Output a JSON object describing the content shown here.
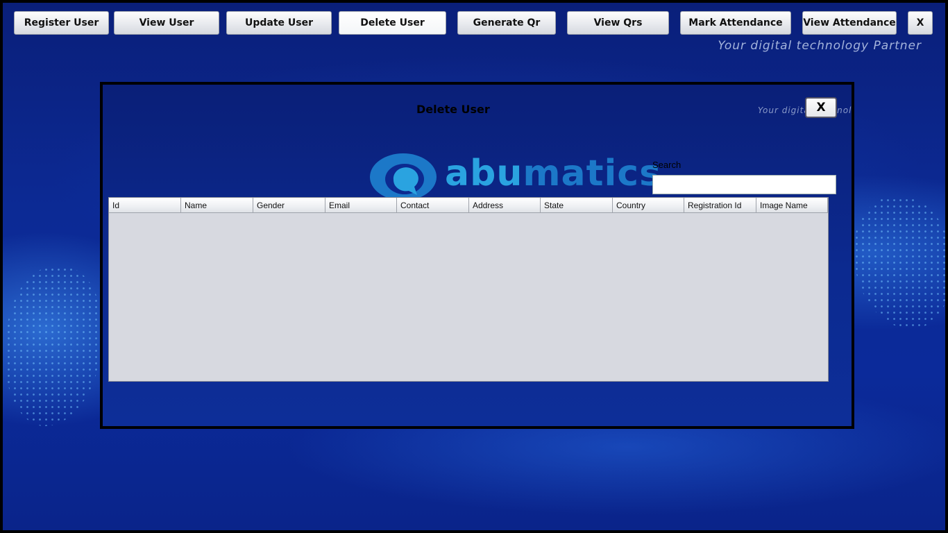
{
  "toolbar": {
    "buttons": [
      {
        "label": "Register User"
      },
      {
        "label": "View User"
      },
      {
        "label": "Update User"
      },
      {
        "label": "Delete User"
      },
      {
        "label": "Generate Qr"
      },
      {
        "label": "View Qrs"
      },
      {
        "label": "Mark Attendance"
      },
      {
        "label": "View Attendance"
      }
    ],
    "close_label": "X"
  },
  "tagline": "Your digital technology Partner",
  "panel": {
    "title": "Delete User",
    "tagline": "Your digital technology Partner",
    "close_label": "X",
    "logo_text_part1": "abu",
    "logo_text_part2": "matics",
    "search": {
      "label": "Search",
      "value": "",
      "placeholder": ""
    },
    "table": {
      "columns": [
        "Id",
        "Name",
        "Gender",
        "Email",
        "Contact",
        "Address",
        "State",
        "Country",
        "Registration Id",
        "Image Name"
      ],
      "rows": []
    }
  },
  "colors": {
    "background": "#0c2a95",
    "logo_light": "#2aa3e0",
    "logo_dark": "#1c78c8"
  }
}
